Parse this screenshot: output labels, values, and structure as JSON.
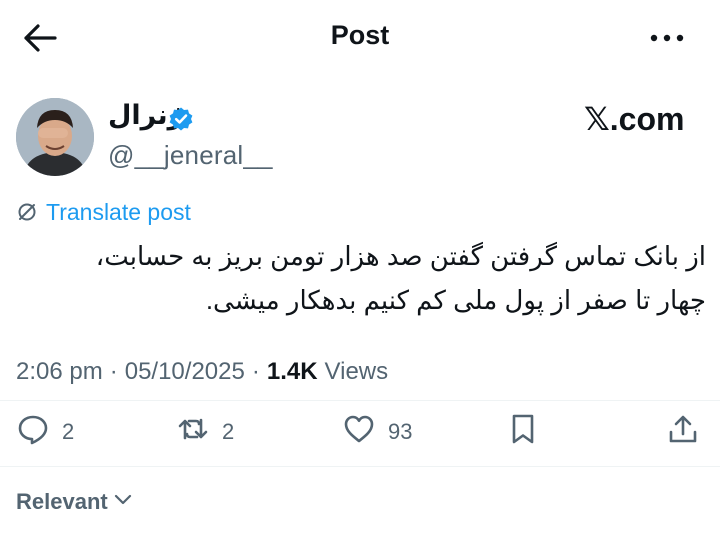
{
  "header": {
    "title": "Post",
    "back_icon": "arrow-left-icon",
    "more_icon": "more-dots-icon"
  },
  "author": {
    "display_name": "ژنرال",
    "handle": "@__jeneral__",
    "verified_color": "#1d9bf0"
  },
  "brand": {
    "label": "𝕏.com"
  },
  "translate": {
    "label": "Translate post",
    "icon": "translate-icon",
    "color": "#1d9bf0"
  },
  "tweet": {
    "text": "از بانک تماس گرفتن گفتن صد هزار تومن بریز به حسابت،\nچهار تا صفر از پول ملی کم کنیم بدهکار میشی."
  },
  "meta": {
    "time": "2:06 pm",
    "separator": "·",
    "date": "05/10/2025",
    "separator2": "·",
    "views_count": "1.4K",
    "views_label": "Views"
  },
  "actions": {
    "reply": {
      "count": "2",
      "icon": "reply-icon"
    },
    "repost": {
      "count": "2",
      "icon": "repost-icon"
    },
    "like": {
      "count": "93",
      "icon": "heart-icon"
    },
    "bookmark": {
      "icon": "bookmark-icon"
    },
    "share": {
      "icon": "share-icon"
    }
  },
  "sort": {
    "label": "Relevant",
    "icon": "chevron-down-icon"
  },
  "colors": {
    "text": "#0f1419",
    "secondary": "#536471",
    "accent": "#1d9bf0",
    "divider": "#eff3f4"
  }
}
